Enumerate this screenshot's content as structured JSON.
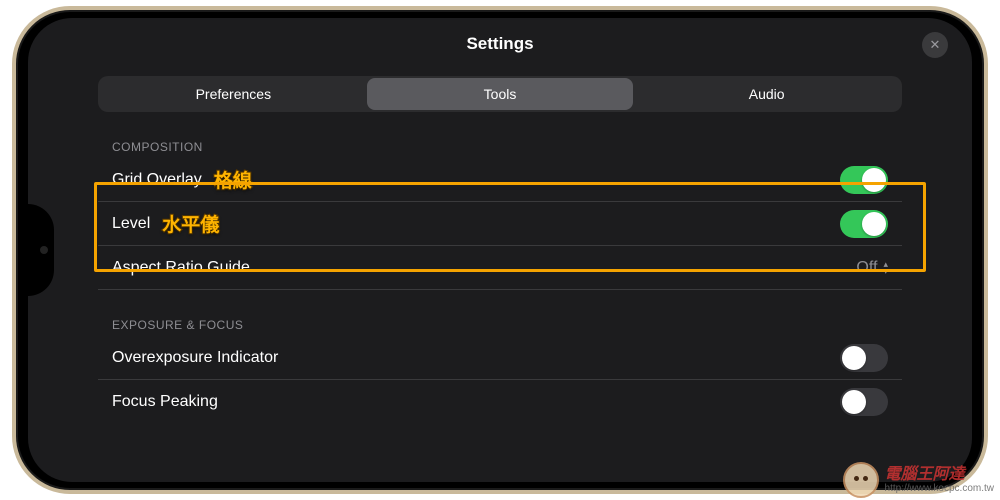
{
  "header": {
    "title": "Settings",
    "close_symbol": "✕"
  },
  "tabs": [
    {
      "label": "Preferences",
      "active": false
    },
    {
      "label": "Tools",
      "active": true
    },
    {
      "label": "Audio",
      "active": false
    }
  ],
  "sections": {
    "composition": {
      "header": "COMPOSITION",
      "grid_overlay": {
        "label": "Grid Overlay",
        "annotation": "格線",
        "on": true
      },
      "level": {
        "label": "Level",
        "annotation": "水平儀",
        "on": true
      },
      "aspect_ratio": {
        "label": "Aspect Ratio Guide",
        "value": "Off"
      }
    },
    "exposure_focus": {
      "header": "EXPOSURE & FOCUS",
      "overexposure": {
        "label": "Overexposure Indicator",
        "on": false
      },
      "focus_peaking": {
        "label": "Focus Peaking",
        "on": false
      }
    }
  },
  "watermark": {
    "title": "電腦王阿達",
    "url": "http://www.kocpc.com.tw"
  }
}
